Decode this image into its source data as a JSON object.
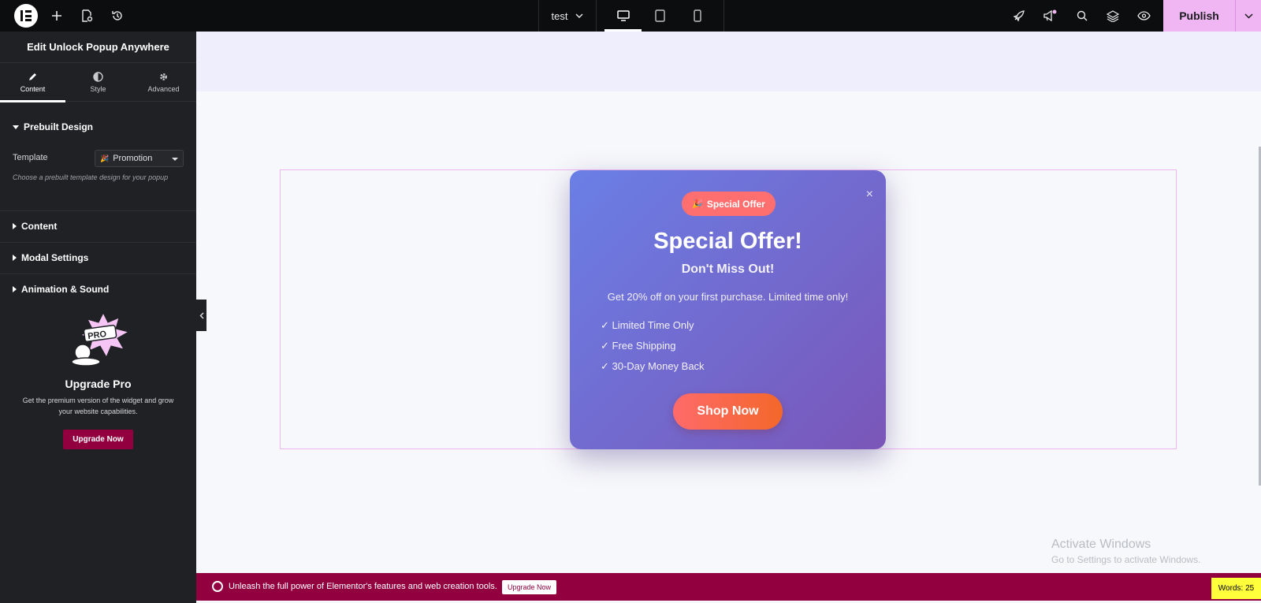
{
  "topbar": {
    "page_name": "test",
    "publish_label": "Publish",
    "icons": [
      "elementor-logo-icon",
      "add-icon",
      "page-settings-icon",
      "history-icon",
      "desktop-icon",
      "tablet-icon",
      "mobile-icon",
      "rocket-icon",
      "megaphone-icon",
      "search-icon",
      "layers-icon",
      "preview-eye-icon",
      "chevron-down-icon"
    ]
  },
  "panel": {
    "title": "Edit Unlock Popup Anywhere",
    "tabs": [
      {
        "label": "Content",
        "icon": "pencil-icon",
        "active": true
      },
      {
        "label": "Style",
        "icon": "contrast-icon",
        "active": false
      },
      {
        "label": "Advanced",
        "icon": "gear-icon",
        "active": false
      }
    ],
    "sections": {
      "prebuilt": "Prebuilt Design",
      "content": "Content",
      "modal": "Modal Settings",
      "animation": "Animation & Sound"
    },
    "template_label": "Template",
    "template_value": "Promotion",
    "template_help": "Choose a prebuilt template design for your popup",
    "promo": {
      "title": "Upgrade Pro",
      "description": "Get the premium version of the widget and grow your website capabilities.",
      "button": "Upgrade Now",
      "image_text": "PRO"
    }
  },
  "popup": {
    "badge": "Special Offer",
    "badge_icon": "party-popper-icon",
    "title": "Special Offer!",
    "subtitle": "Don't Miss Out!",
    "text": "Get 20% off on your first purchase. Limited time only!",
    "features": [
      "✓ Limited Time Only",
      "✓ Free Shipping",
      "✓ 30-Day Money Back"
    ],
    "button": "Shop Now",
    "close": "×"
  },
  "watermark": {
    "line1": "Activate Windows",
    "line2": "Go to Settings to activate Windows."
  },
  "bottombar": {
    "text": "Unleash the full power of Elementor's features and web creation tools.",
    "button": "Upgrade Now",
    "words": "Words: 25"
  },
  "colors": {
    "accent_pink": "#f0b6f3",
    "brand_maroon": "#93003f",
    "popup_gradient_start": "#6a7fe6",
    "popup_gradient_end": "#7a56b8",
    "cta_coral": "#ff6a6a"
  }
}
